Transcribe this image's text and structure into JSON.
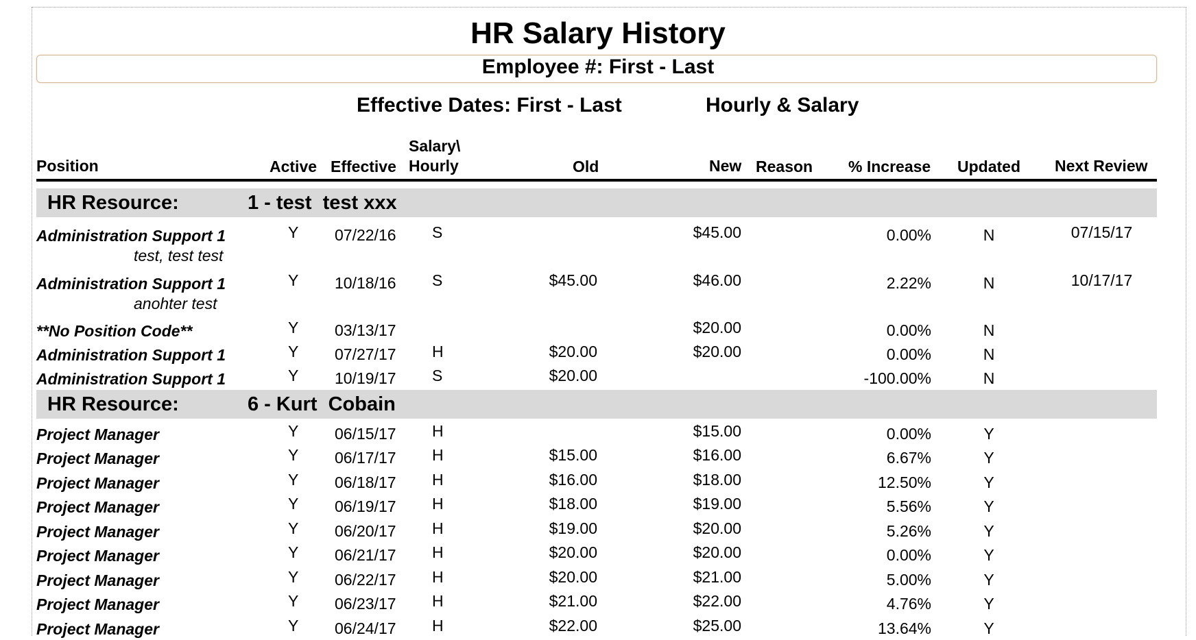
{
  "report": {
    "title": "HR Salary History",
    "employee_range": "Employee #: First  -  Last",
    "effective_dates": "Effective Dates: First  -  Last",
    "pay_type": "Hourly & Salary"
  },
  "columns": {
    "position": "Position",
    "active": "Active",
    "effective": "Effective",
    "salary_hourly_1": "Salary\\",
    "salary_hourly_2": "Hourly",
    "old": "Old",
    "new": "New",
    "reason": "Reason",
    "pct_increase": "% Increase",
    "updated": "Updated",
    "next_review": "Next Review"
  },
  "groups": [
    {
      "label": "HR Resource:",
      "resource": "1 - test  test xxx",
      "rows": [
        {
          "position": "Administration Support 1",
          "active": "Y",
          "effective": "07/22/16",
          "type": "S",
          "old": "",
          "new": "$45.00",
          "pct": "0.00%",
          "updated": "N",
          "next_review": "07/15/17",
          "note": "test, test test"
        },
        {
          "position": "Administration Support 1",
          "active": "Y",
          "effective": "10/18/16",
          "type": "S",
          "old": "$45.00",
          "new": "$46.00",
          "pct": "2.22%",
          "updated": "N",
          "next_review": "10/17/17",
          "note": "anohter test"
        },
        {
          "position": "**No Position Code**",
          "active": "Y",
          "effective": "03/13/17",
          "type": "",
          "old": "",
          "new": "$20.00",
          "pct": "0.00%",
          "updated": "N",
          "next_review": ""
        },
        {
          "position": "Administration Support 1",
          "active": "Y",
          "effective": "07/27/17",
          "type": "H",
          "old": "$20.00",
          "new": "$20.00",
          "pct": "0.00%",
          "updated": "N",
          "next_review": ""
        },
        {
          "position": "Administration Support 1",
          "active": "Y",
          "effective": "10/19/17",
          "type": "S",
          "old": "$20.00",
          "new": "",
          "pct": "-100.00%",
          "updated": "N",
          "next_review": ""
        }
      ]
    },
    {
      "label": "HR Resource:",
      "resource": "6 - Kurt  Cobain",
      "rows": [
        {
          "position": "Project Manager",
          "active": "Y",
          "effective": "06/15/17",
          "type": "H",
          "old": "",
          "new": "$15.00",
          "pct": "0.00%",
          "updated": "Y",
          "next_review": ""
        },
        {
          "position": "Project Manager",
          "active": "Y",
          "effective": "06/17/17",
          "type": "H",
          "old": "$15.00",
          "new": "$16.00",
          "pct": "6.67%",
          "updated": "Y",
          "next_review": ""
        },
        {
          "position": "Project Manager",
          "active": "Y",
          "effective": "06/18/17",
          "type": "H",
          "old": "$16.00",
          "new": "$18.00",
          "pct": "12.50%",
          "updated": "Y",
          "next_review": ""
        },
        {
          "position": "Project Manager",
          "active": "Y",
          "effective": "06/19/17",
          "type": "H",
          "old": "$18.00",
          "new": "$19.00",
          "pct": "5.56%",
          "updated": "Y",
          "next_review": ""
        },
        {
          "position": "Project Manager",
          "active": "Y",
          "effective": "06/20/17",
          "type": "H",
          "old": "$19.00",
          "new": "$20.00",
          "pct": "5.26%",
          "updated": "Y",
          "next_review": ""
        },
        {
          "position": "Project Manager",
          "active": "Y",
          "effective": "06/21/17",
          "type": "H",
          "old": "$20.00",
          "new": "$20.00",
          "pct": "0.00%",
          "updated": "Y",
          "next_review": ""
        },
        {
          "position": "Project Manager",
          "active": "Y",
          "effective": "06/22/17",
          "type": "H",
          "old": "$20.00",
          "new": "$21.00",
          "pct": "5.00%",
          "updated": "Y",
          "next_review": ""
        },
        {
          "position": "Project Manager",
          "active": "Y",
          "effective": "06/23/17",
          "type": "H",
          "old": "$21.00",
          "new": "$22.00",
          "pct": "4.76%",
          "updated": "Y",
          "next_review": ""
        },
        {
          "position": "Project Manager",
          "active": "Y",
          "effective": "06/24/17",
          "type": "H",
          "old": "$22.00",
          "new": "$25.00",
          "pct": "13.64%",
          "updated": "Y",
          "next_review": ""
        }
      ]
    }
  ]
}
